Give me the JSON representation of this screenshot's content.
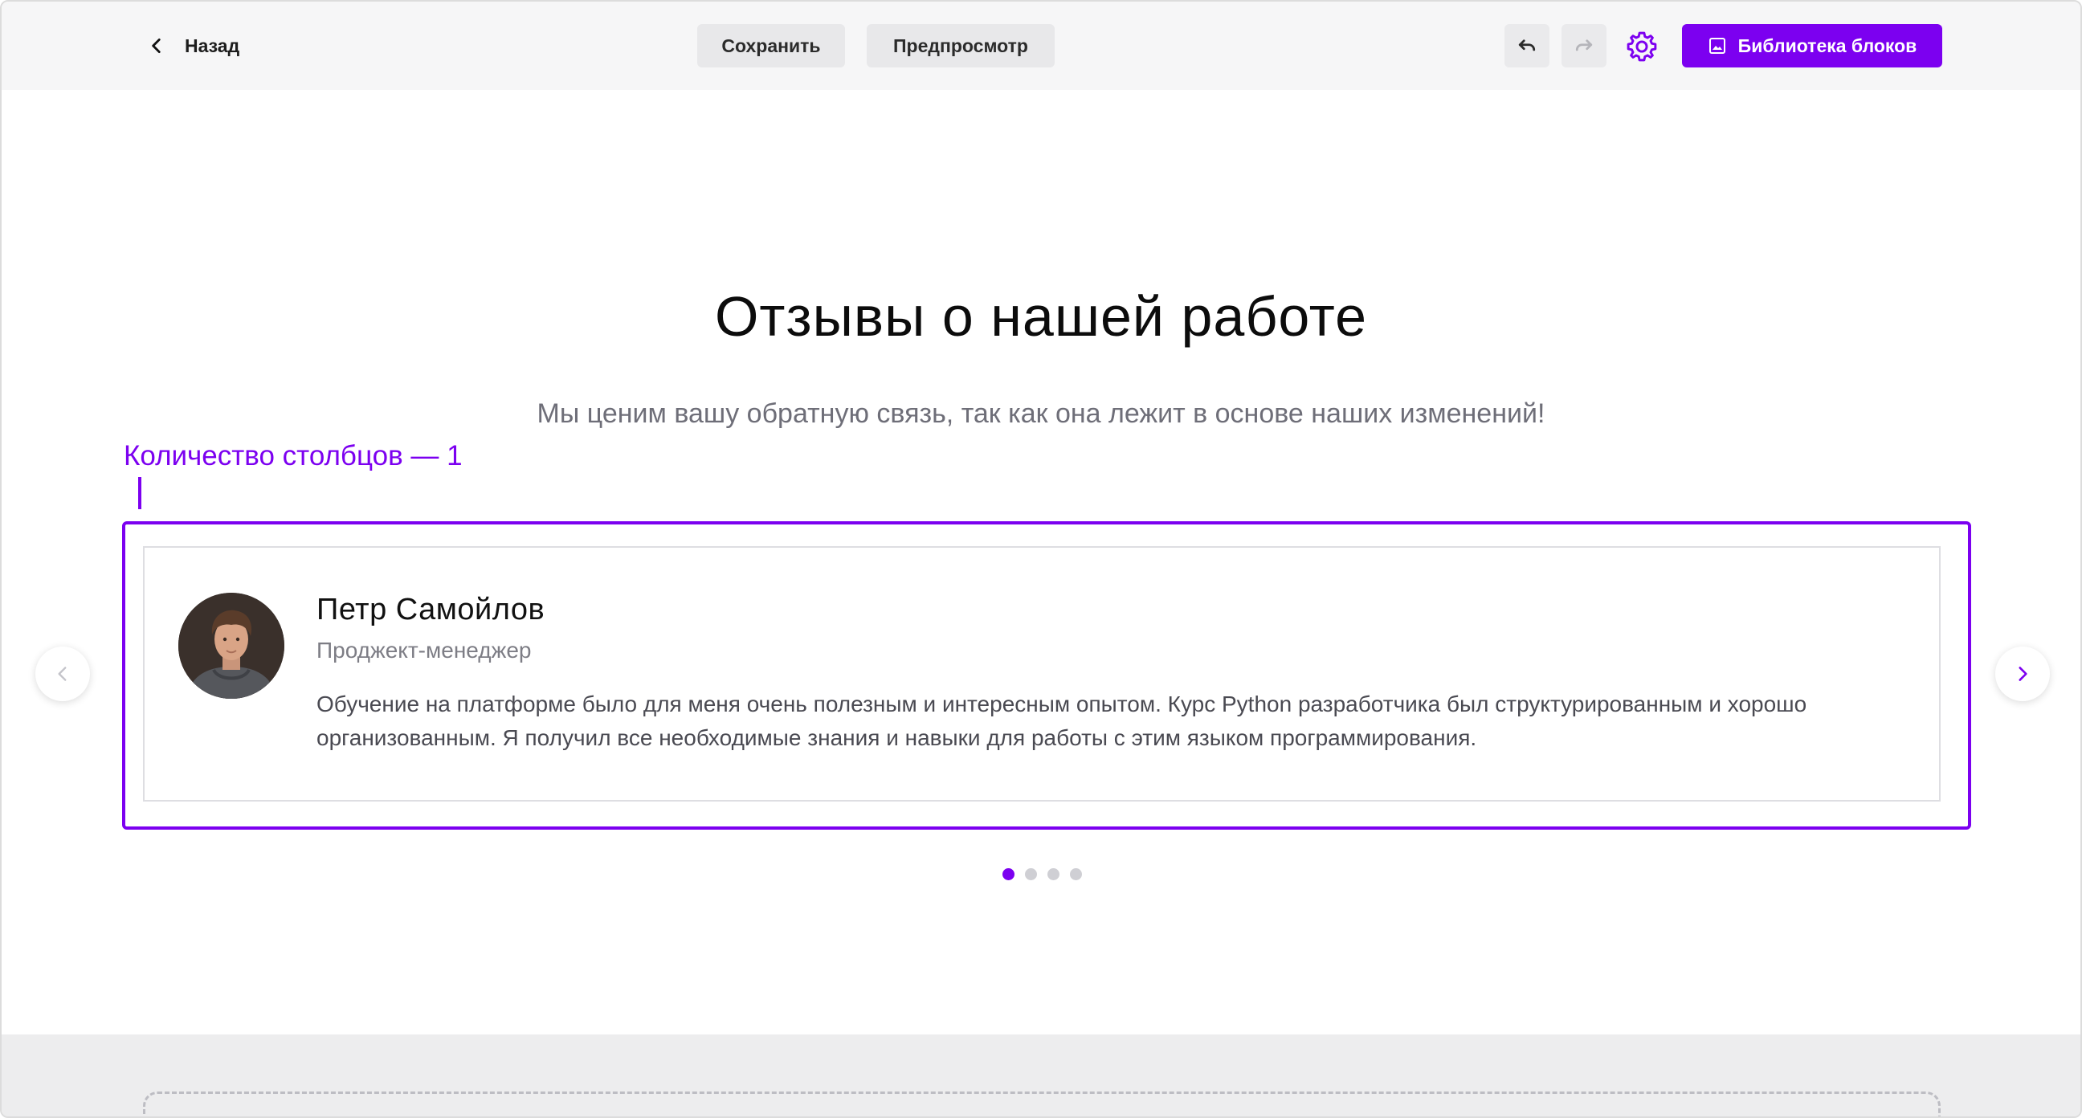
{
  "toolbar": {
    "back_label": "Назад",
    "save_label": "Сохранить",
    "preview_label": "Предпросмотр",
    "library_label": "Библиотека блоков"
  },
  "section": {
    "title": "Отзывы о нашей работе",
    "subtitle": "Мы ценим вашу обратную связь, так как она лежит в основе наших изменений!"
  },
  "annotation": {
    "label": "Количество столбцов — 1"
  },
  "testimonial": {
    "name": "Петр Самойлов",
    "role": "Проджект-менеджер",
    "text": "Обучение на платформе было для меня очень полезным и интересным опытом. Курс Python разработчика был структурированным и хорошо организованным. Я получил все необходимые знания и навыки для работы с этим языком программирования."
  },
  "pagination": {
    "total": 4,
    "active_index": 0
  },
  "colors": {
    "accent": "#7c00f0",
    "toolbar_bg": "#f6f6f7",
    "button_gray": "#e8e8ea"
  },
  "icons": {
    "back": "chevron-left-icon",
    "undo": "undo-icon",
    "redo": "redo-icon",
    "settings": "gear-icon",
    "library": "image-icon",
    "prev": "chevron-left-icon",
    "next": "chevron-right-icon"
  }
}
